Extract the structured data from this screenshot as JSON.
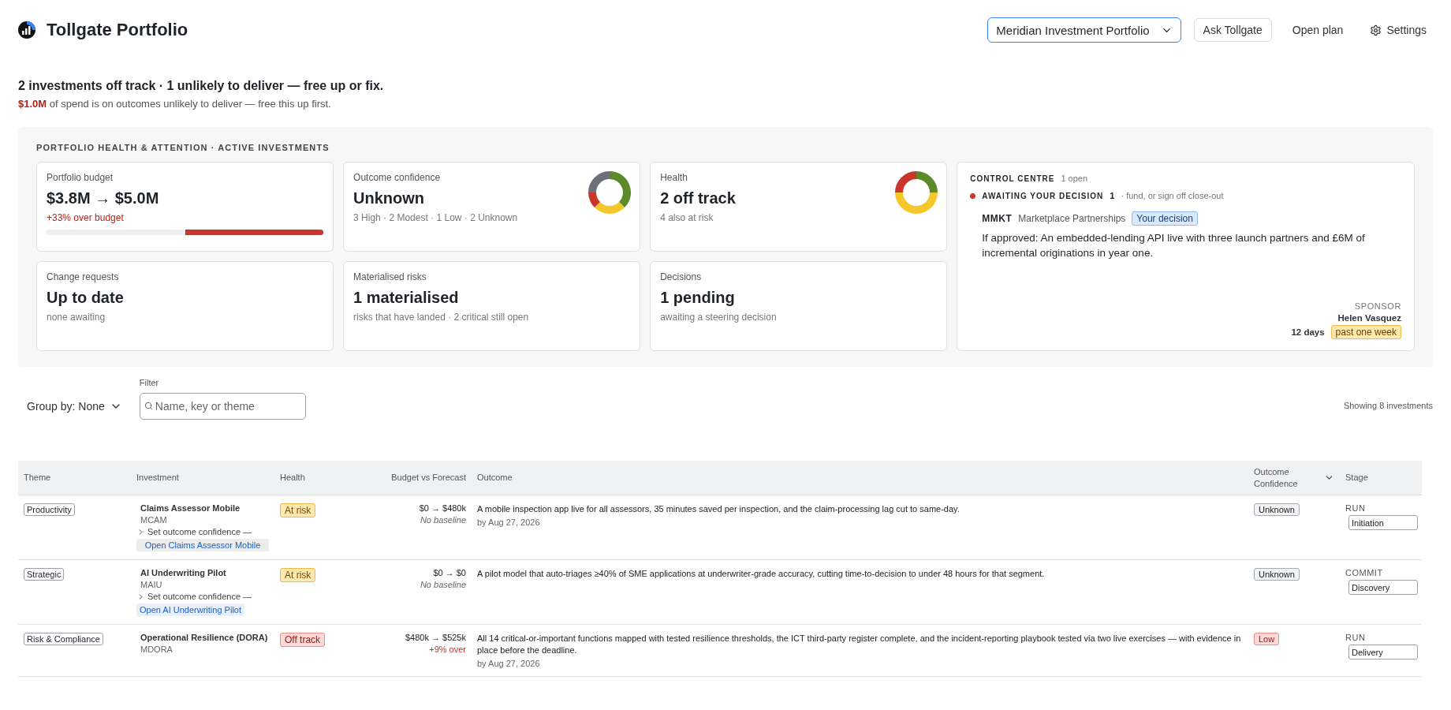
{
  "header": {
    "title": "Tollgate Portfolio",
    "portfolio_select": "Meridian Investment Portfolio",
    "ask_button": "Ask Tollgate",
    "open_plan": "Open plan",
    "settings": "Settings"
  },
  "summary": {
    "headline": "2 investments off track · 1 unlikely to deliver — free up or fix.",
    "amount": "$1.0M",
    "note": "of spend is on outcomes unlikely to deliver — free this up first."
  },
  "panel": {
    "title": "PORTFOLIO HEALTH & ATTENTION · ACTIVE INVESTMENTS",
    "cards": [
      {
        "kind": "budget",
        "label": "Portfolio budget",
        "value": "$3.8M → $5.0M",
        "detail": "+33% over budget",
        "level": 0.5
      },
      {
        "kind": "confidence_donut",
        "label": "Outcome confidence",
        "value": "Unknown",
        "detail": "3 High · 2 Modest · 1 Low · 2 Unknown"
      },
      {
        "kind": "health_donut",
        "label": "Health",
        "value": "2 off track",
        "detail": "4 also at risk"
      },
      {
        "kind": "plain",
        "label": "Change requests",
        "value": "Up to date",
        "detail": "none awaiting"
      },
      {
        "kind": "plain",
        "label": "Materialised risks",
        "value": "1 materialised",
        "detail": "risks that have landed · 2 critical still open"
      },
      {
        "kind": "plain",
        "label": "Decisions",
        "value": "1 pending",
        "detail": "awaiting a steering decision"
      }
    ],
    "control_centre": {
      "title": "CONTROL CENTRE",
      "count": "1 open",
      "group": {
        "label": "AWAITING YOUR DECISION",
        "count": "1",
        "note": "· fund, or sign off close-out",
        "color": "#d0342c"
      },
      "item": {
        "key": "MMKT",
        "name": "Marketplace Partnerships",
        "tag": "Your decision",
        "description": "If approved: An embedded-lending API live with three launch partners and £6M of incremental originations in year one.",
        "sponsor_label": "SPONSOR",
        "sponsor": "Helen Vasquez",
        "age": "12 days",
        "age_tag": "past one week"
      }
    }
  },
  "toolbar": {
    "group_by": "Group by: None",
    "filter_label": "Filter",
    "filter_placeholder": "Name, key or theme",
    "count": "Showing 8 investments"
  },
  "table": {
    "columns": [
      {
        "label": "Theme",
        "sortable": false
      },
      {
        "label": "Investment",
        "sortable": false
      },
      {
        "label": "Health",
        "sortable": false
      },
      {
        "label": "Budget vs Forecast",
        "sortable": false
      },
      {
        "label": "Outcome",
        "sortable": false
      },
      {
        "label": "Outcome Confidence",
        "sortable": true
      },
      {
        "label": "Stage",
        "sortable": false
      }
    ],
    "rows": [
      {
        "theme": "Productivity",
        "name": "Claims Assessor Mobile",
        "key": "MCAM",
        "confidence_toggle": "Set outcome confidence —",
        "open_link": "Open Claims Assessor Mobile",
        "link_focused": true,
        "health": {
          "label": "At risk",
          "kind": "at_risk"
        },
        "budget": "$0 → $480k",
        "variance": {
          "text": "No baseline",
          "kind": "note"
        },
        "outcome": "A mobile inspection app live for all assessors, 35 minutes saved per inspection, and the claim-processing lag cut to same-day.",
        "due": "by Aug 27, 2026",
        "confidence": {
          "label": "Unknown",
          "kind": "unknown"
        },
        "stage": "RUN",
        "stage_select": "Initiation"
      },
      {
        "theme": "Strategic",
        "name": "AI Underwriting Pilot",
        "key": "MAIU",
        "confidence_toggle": "Set outcome confidence —",
        "open_link": "Open AI Underwriting Pilot",
        "link_focused": false,
        "health": {
          "label": "At risk",
          "kind": "at_risk"
        },
        "budget": "$0 → $0",
        "variance": {
          "text": "No baseline",
          "kind": "note"
        },
        "outcome": "A pilot model that auto-triages ≥40% of SME applications at underwriter-grade accuracy, cutting time-to-decision to under 48 hours for that segment.",
        "confidence": {
          "label": "Unknown",
          "kind": "unknown"
        },
        "stage": "COMMIT",
        "stage_select": "Discovery"
      },
      {
        "theme": "Risk & Compliance",
        "name": "Operational Resilience (DORA)",
        "key": "MDORA",
        "health": {
          "label": "Off track",
          "kind": "off_track"
        },
        "budget": "$480k → $525k",
        "variance": {
          "text": "+9% over",
          "kind": "over"
        },
        "outcome": "All 14 critical-or-important functions mapped with tested resilience thresholds, the ICT third-party register complete, and the incident-reporting playbook tested via two live exercises — with evidence in place before the deadline.",
        "due": "by Aug 27, 2026",
        "confidence": {
          "label": "Low",
          "kind": "low"
        },
        "stage": "RUN",
        "stage_select": "Delivery"
      }
    ]
  }
}
